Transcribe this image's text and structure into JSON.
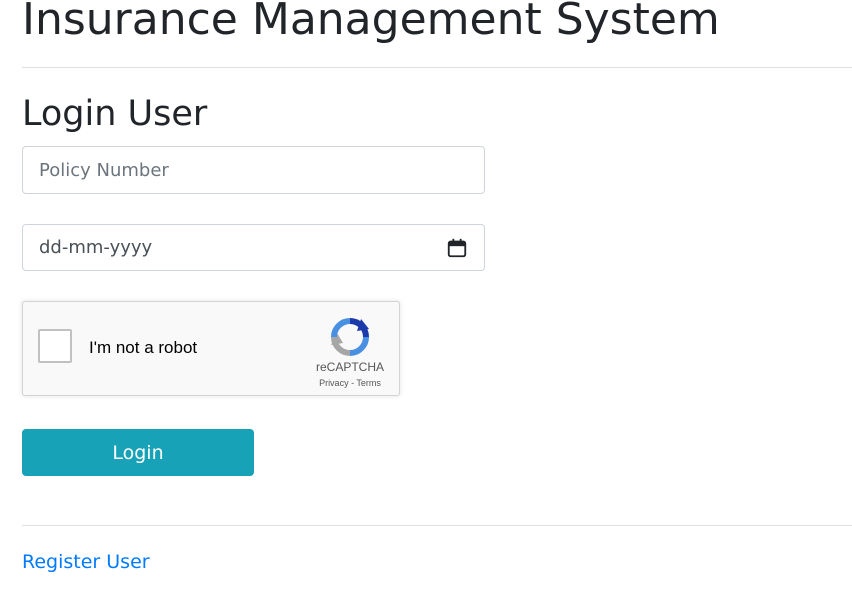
{
  "header": {
    "title": "Insurance Management System"
  },
  "form": {
    "title": "Login User",
    "policy_number": {
      "placeholder": "Policy Number",
      "value": ""
    },
    "date": {
      "placeholder": "dd-mm-yyyy",
      "icon": "calendar-icon"
    },
    "captcha": {
      "label": "I'm not a robot",
      "brand": "reCAPTCHA",
      "privacy_link": "Privacy",
      "separator": " - ",
      "terms_link": "Terms",
      "checked": false
    },
    "login_label": "Login"
  },
  "footer": {
    "register_link": "Register User"
  },
  "colors": {
    "primary_button": "#17a2b8",
    "link": "#007bff",
    "text": "#212529",
    "border": "#ced4da"
  }
}
